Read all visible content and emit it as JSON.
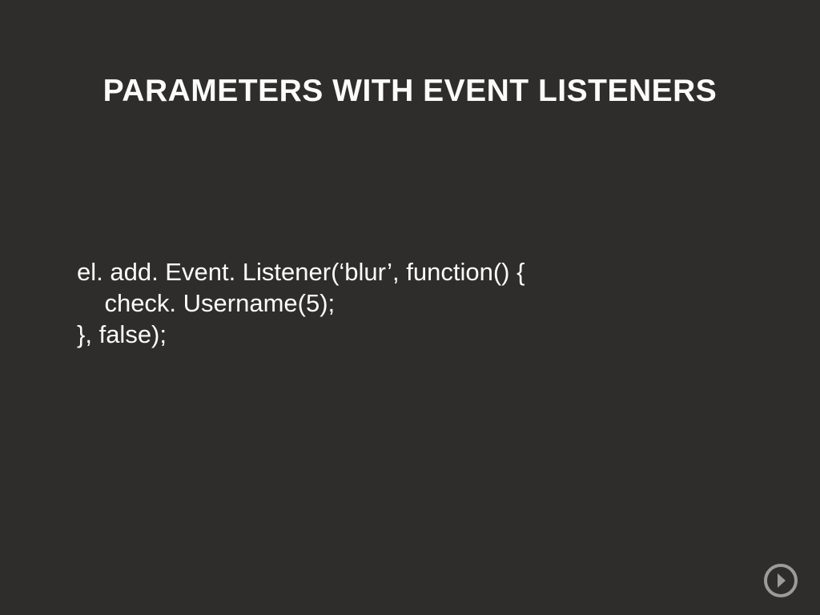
{
  "slide": {
    "title": "PARAMETERS WITH EVENT LISTENERS",
    "code": "el. add. Event. Listener(‘blur’, function() {\n    check. Username(5);\n}, false);"
  },
  "nav": {
    "next_label": "Next"
  }
}
